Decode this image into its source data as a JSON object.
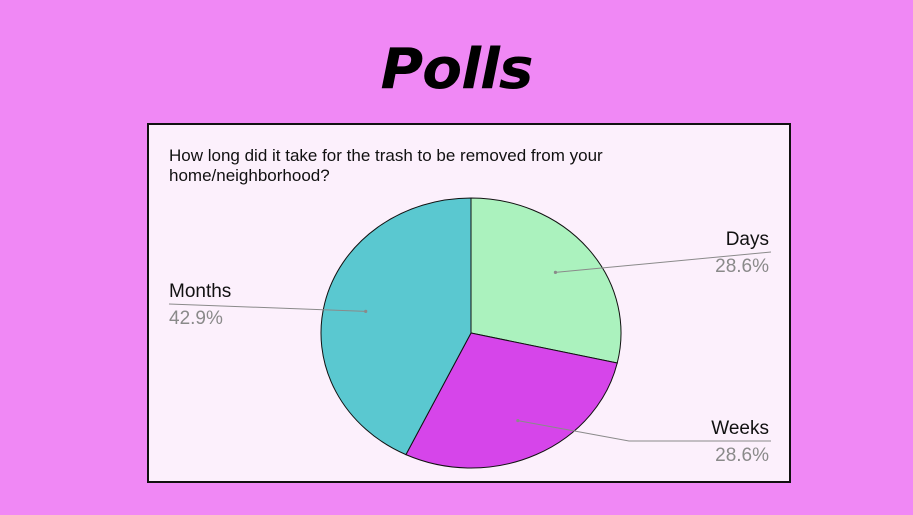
{
  "slide": {
    "title": "Polls",
    "background": "#F088F5"
  },
  "chart_data": {
    "type": "pie",
    "title": "How long did it take for the trash to be removed from your home/neighborhood?",
    "slices": [
      {
        "label": "Days",
        "value": 28.6,
        "value_label": "28.6%",
        "color": "#ABF2BE"
      },
      {
        "label": "Weeks",
        "value": 28.6,
        "value_label": "28.6%",
        "color": "#D645EA"
      },
      {
        "label": "Months",
        "value": 42.9,
        "value_label": "42.9%",
        "color": "#5AC8D0"
      }
    ],
    "start": "12 o'clock",
    "direction": "clockwise",
    "legend": "none"
  }
}
